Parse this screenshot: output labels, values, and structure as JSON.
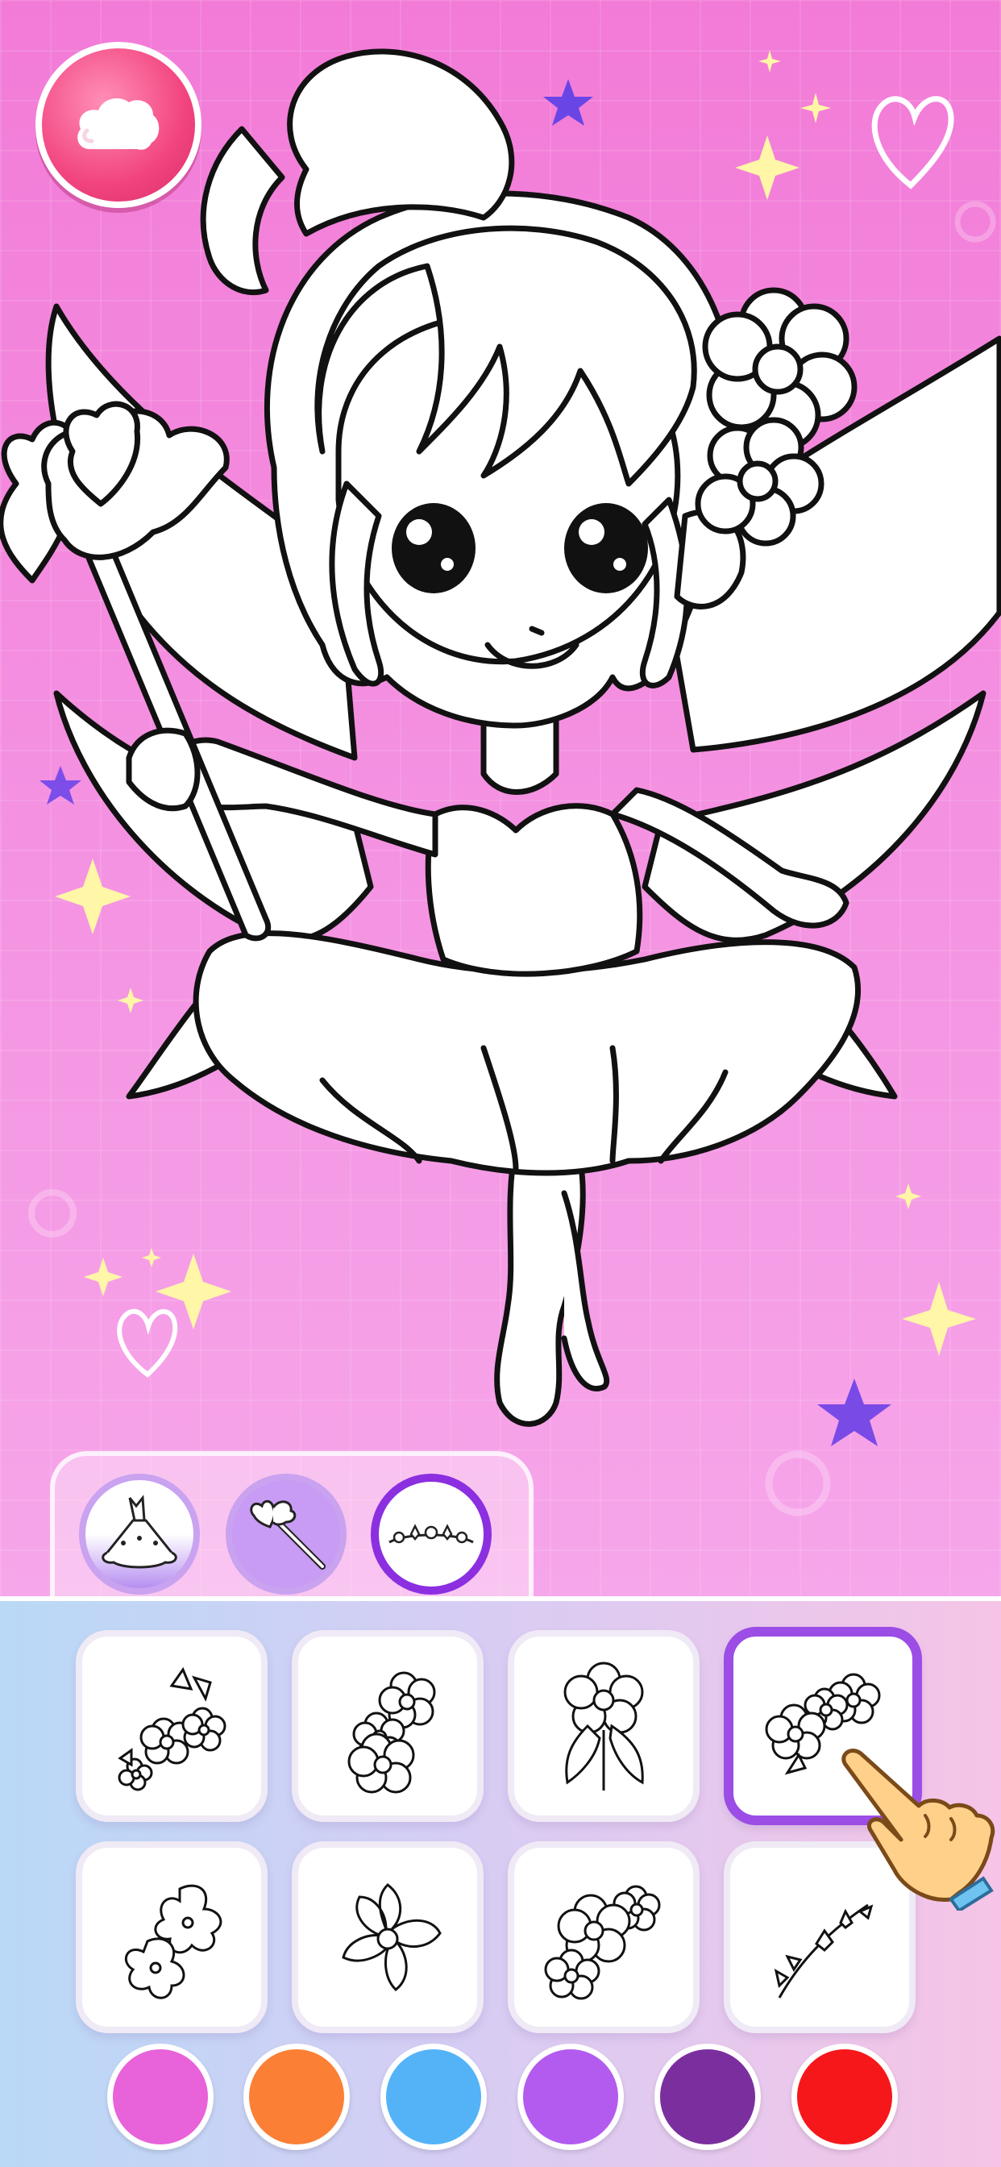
{
  "screen": {
    "name": "fairy-coloring-page",
    "back_icon": "cloud-back-icon"
  },
  "tool_tabs": [
    {
      "name": "tutu-dress",
      "icon": "tutu-icon"
    },
    {
      "name": "magic-wand",
      "icon": "wand-icon"
    },
    {
      "name": "flower-crown",
      "icon": "crown-icon",
      "selected": true
    }
  ],
  "stickers": [
    {
      "name": "flower-cluster-1",
      "icon": "flower-cluster-icon"
    },
    {
      "name": "flower-cluster-2",
      "icon": "flower-cluster-icon"
    },
    {
      "name": "flower-with-leaves",
      "icon": "flower-leaves-icon"
    },
    {
      "name": "flower-cluster-3",
      "icon": "flower-cluster-icon",
      "selected": true
    },
    {
      "name": "plumeria-flowers",
      "icon": "plumeria-icon"
    },
    {
      "name": "single-flower",
      "icon": "single-flower-icon"
    },
    {
      "name": "round-flowers",
      "icon": "round-flowers-icon"
    },
    {
      "name": "flower-vine",
      "icon": "vine-icon"
    }
  ],
  "colors": [
    "#e862d9",
    "#fb7f35",
    "#54b3f7",
    "#b35bef",
    "#7b2f9e",
    "#f6171b"
  ],
  "accent_color": "#9b4de6",
  "hint": {
    "icon": "pointing-hand-icon"
  }
}
